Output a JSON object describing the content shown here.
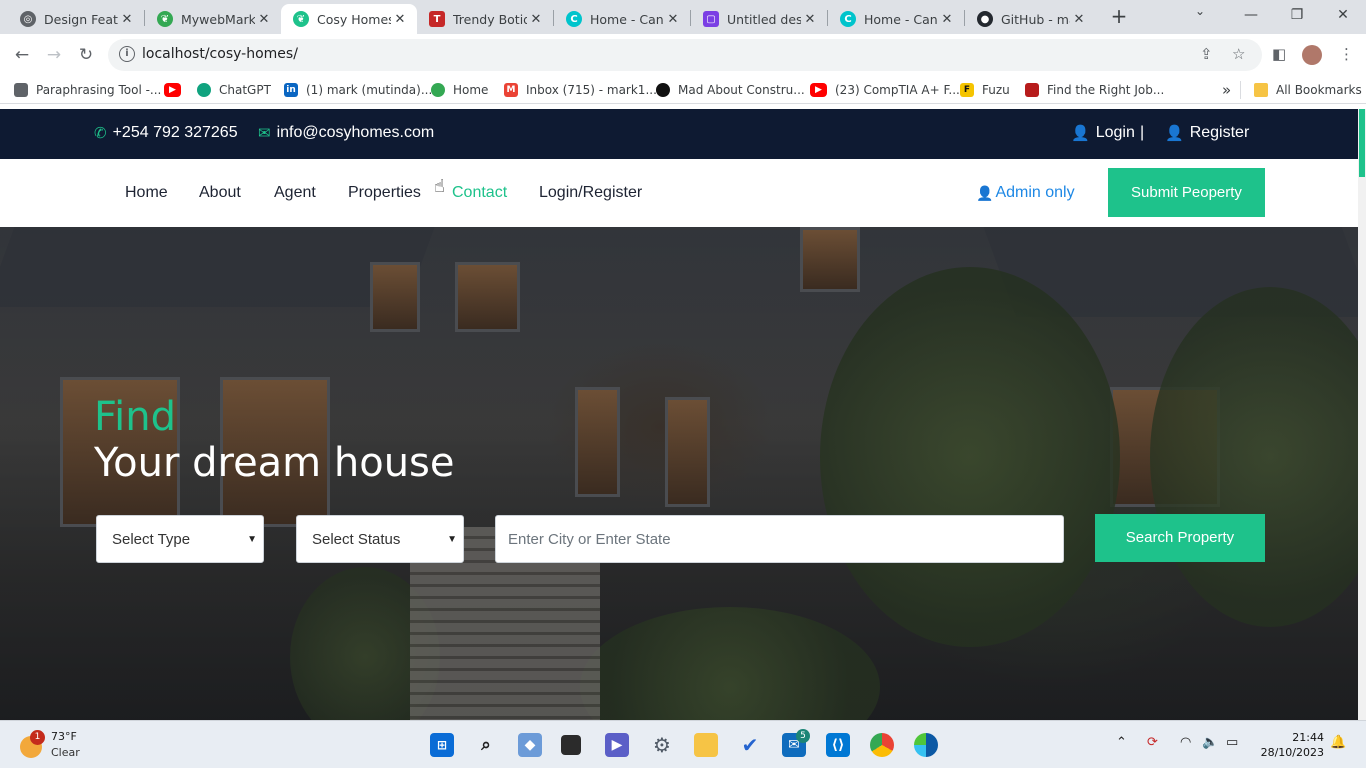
{
  "browser": {
    "tabs": [
      {
        "label": "Design Featu",
        "fav_color": "#5f6368",
        "icon": "openai-icon"
      },
      {
        "label": "MywebMark",
        "fav_color": "#34a853",
        "icon": "leaf-icon"
      },
      {
        "label": "Cosy Homes",
        "fav_color": "#1ec28b",
        "icon": "leaf-icon"
      },
      {
        "label": "Trendy Botiq",
        "fav_color": "#c62828",
        "icon": "shop-icon"
      },
      {
        "label": "Home - Canv",
        "fav_color": "#00c4cc",
        "icon": "canva-icon"
      },
      {
        "label": "Untitled desi",
        "fav_color": "#7b3fe4",
        "icon": "canva-design-icon"
      },
      {
        "label": "Home - Canv",
        "fav_color": "#00c4cc",
        "icon": "canva-icon"
      },
      {
        "label": "GitHub - ma",
        "fav_color": "#24292f",
        "icon": "github-icon"
      }
    ],
    "url": "localhost/cosy-homes/",
    "bookmarks": [
      {
        "label": "Paraphrasing Tool -...",
        "color": "#5f6368"
      },
      {
        "label": "",
        "color": "#ff0000"
      },
      {
        "label": "ChatGPT",
        "color": "#10a37f"
      },
      {
        "label": "(1) mark (mutinda)...",
        "color": "#0a66c2"
      },
      {
        "label": "Home",
        "color": "#34a853"
      },
      {
        "label": "Inbox (715) - mark1...",
        "color": "#ea4335"
      },
      {
        "label": "Mad About Constru...",
        "color": "#111111"
      },
      {
        "label": "(23) CompTIA A+ F...",
        "color": "#ff0000"
      },
      {
        "label": "Fuzu",
        "color": "#f5c400"
      },
      {
        "label": "Find the Right Job...",
        "color": "#b71c1c"
      }
    ],
    "bookmarks_more": "»",
    "all_bookmarks": "All Bookmarks"
  },
  "topbar": {
    "phone": "+254 792 327265",
    "email": "info@cosyhomes.com",
    "login": "Login",
    "separator": "|",
    "register": "Register"
  },
  "nav": {
    "links": [
      "Home",
      "About",
      "Agent",
      "Properties",
      "Contact",
      "Login/Register"
    ],
    "active": "Contact",
    "admin": "Admin only",
    "submit": "Submit Peoperty"
  },
  "hero": {
    "find": "Find",
    "title": "Your dream house",
    "type_select": "Select Type",
    "status_select": "Select Status",
    "city_placeholder": "Enter City or Enter State",
    "search_button": "Search Property"
  },
  "colors": {
    "accent": "#1ec28b",
    "topbar": "#0e1a32",
    "admin_link": "#1e88e5"
  },
  "taskbar": {
    "weather_temp": "73°F",
    "weather_cond": "Clear",
    "weather_badge": "1",
    "mail_badge": "5",
    "time": "21:44",
    "date": "28/10/2023"
  }
}
